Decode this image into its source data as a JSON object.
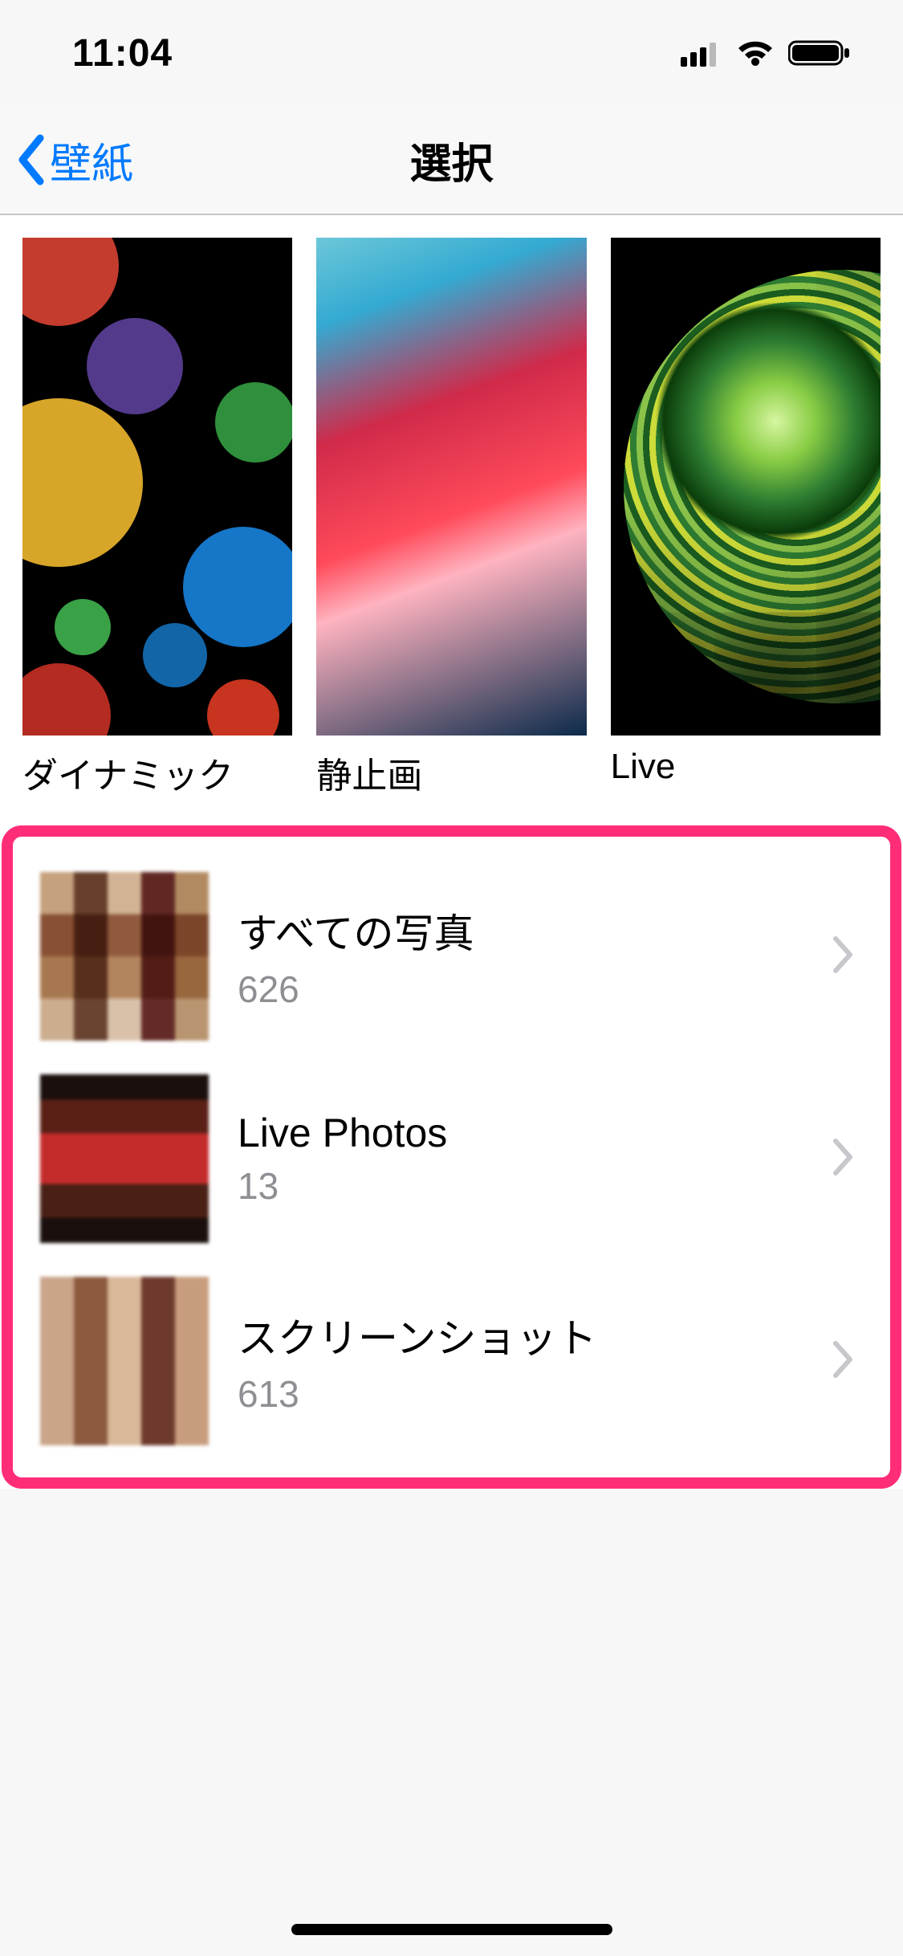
{
  "status": {
    "time": "11:04"
  },
  "nav": {
    "back_label": "壁紙",
    "title": "選択"
  },
  "categories": [
    {
      "label": "ダイナミック"
    },
    {
      "label": "静止画"
    },
    {
      "label": "Live"
    }
  ],
  "albums": [
    {
      "title": "すべての写真",
      "count": "626"
    },
    {
      "title": "Live Photos",
      "count": "13"
    },
    {
      "title": "スクリーンショット",
      "count": "613"
    }
  ]
}
